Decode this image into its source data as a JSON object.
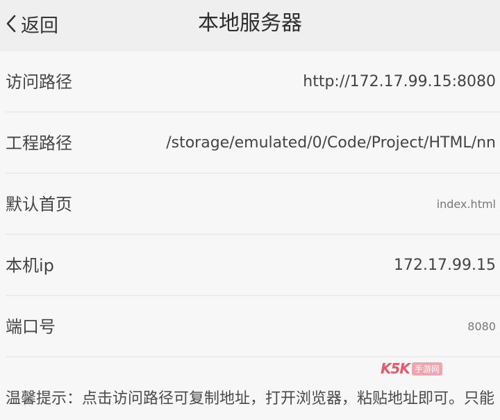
{
  "header": {
    "back_label": "返回",
    "title": "本地服务器"
  },
  "rows": [
    {
      "label": "访问路径",
      "value": "http://172.17.99.15:8080"
    },
    {
      "label": "工程路径",
      "value": "/storage/emulated/0/Code/Project/HTML/nn"
    },
    {
      "label": "默认首页",
      "value": "index.html"
    },
    {
      "label": "本机ip",
      "value": "172.17.99.15"
    },
    {
      "label": "端口号",
      "value": "8080"
    }
  ],
  "tip": "温馨提示：点击访问路径可复制地址，打开浏览器，粘贴地址即可。只能",
  "watermark": {
    "logo": "K5K",
    "tag": "手游网"
  }
}
